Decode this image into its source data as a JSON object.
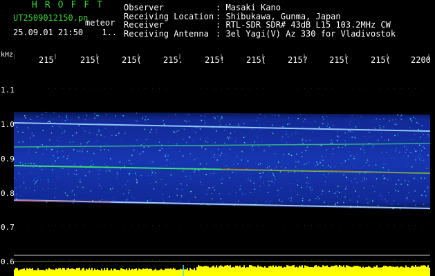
{
  "header": {
    "title_letters": "HROFFT",
    "file_name": "UT2509012150.pn",
    "file_tag": "meteor",
    "datetime": "25.09.01 21:50",
    "page_indicator": "1..",
    "fields": [
      {
        "label": "Observer",
        "value": ": Masaki Kano"
      },
      {
        "label": "Receiving Location",
        "value": ": Shibukawa, Gunma, Japan"
      },
      {
        "label": "Receiver",
        "value": ": RTL-SDR SDR# 43dB L15 103.2MHz CW"
      },
      {
        "label": "Receiving Antenna",
        "value": ": 3el Yagi(V) Az 330 for Vladivostok"
      }
    ]
  },
  "axis": {
    "y_unit": "kHz",
    "y_ticks": [
      {
        "label": "1.1",
        "value": 1.1
      },
      {
        "label": "1.0",
        "value": 1.0
      },
      {
        "label": "0.9",
        "value": 0.9
      },
      {
        "label": "0.8",
        "value": 0.8
      },
      {
        "label": "0.7",
        "value": 0.7
      },
      {
        "label": "0.6",
        "value": 0.6
      }
    ],
    "x_ticks": [
      "215",
      "215(",
      "215(",
      "215.",
      "215!",
      "215(",
      "215?",
      "215(",
      "215(",
      "2200"
    ]
  },
  "colors": {
    "header_green": "#37d637",
    "signal_blue": "#1a3fd0",
    "trace_red": "#ff2a00",
    "amplitude_yellow": "#ffff00"
  }
}
